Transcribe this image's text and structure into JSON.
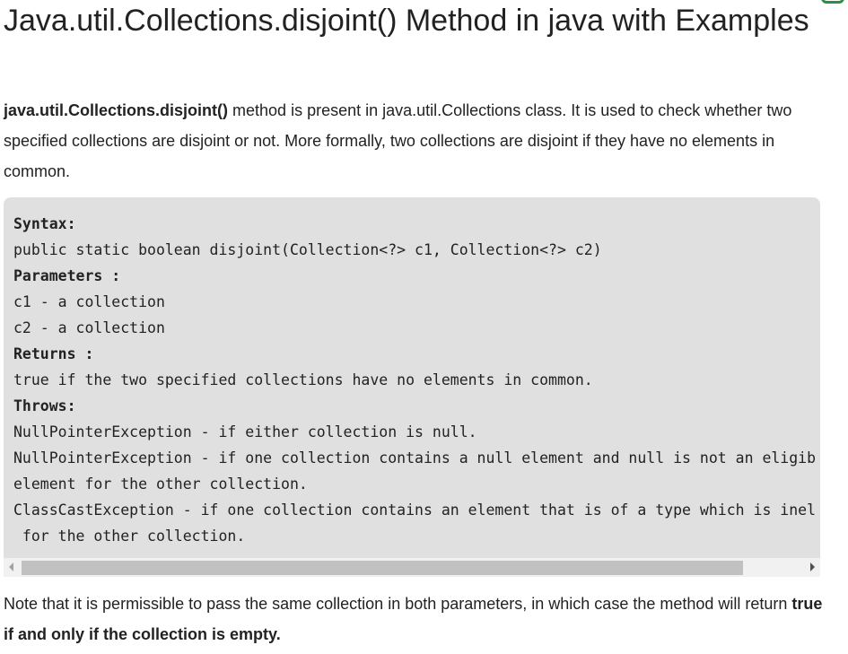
{
  "title": "Java.util.Collections.disjoint() Method in java with Examples",
  "intro": {
    "method_name": "java.util.Collections.disjoint()",
    "text": " method is present in java.util.Collections class. It is used to check whether two specified collections are disjoint or not. More formally, two collections are disjoint if they have no elements in common."
  },
  "code": {
    "syntax_label": "Syntax:",
    "signature": "public static boolean disjoint(Collection<?> c1, Collection<?> c2)",
    "parameters_label": "Parameters :",
    "param_c1": "c1 - a collection",
    "param_c2": "c2 - a collection",
    "returns_label": "Returns :",
    "returns_text": "true if the two specified collections have no elements in common.",
    "throws_label": "Throws:",
    "throws_1": "NullPointerException - if either collection is null.",
    "throws_2a": "NullPointerException - if one collection contains a null element and null is not an eligib",
    "throws_2b": "element for the other collection.",
    "throws_3a": "ClassCastException - if one collection contains an element that is of a type which is inel",
    "throws_3b": " for the other collection."
  },
  "note": {
    "text": "Note that it is permissible to pass the same collection in both parameters, in which case the method will return ",
    "bold_text": "true if and only if the collection is empty."
  }
}
